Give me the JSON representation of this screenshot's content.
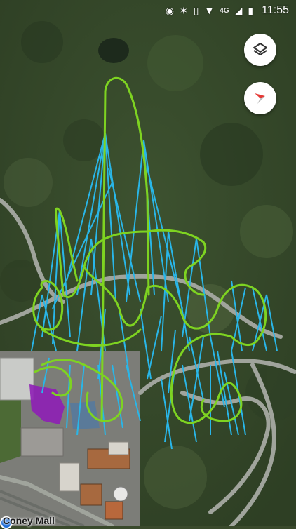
{
  "status_bar": {
    "network": "4G",
    "time": "11:55",
    "icons": [
      "location-icon",
      "bluetooth-icon",
      "vibrate-icon",
      "wifi-icon",
      "signal-icon",
      "battery-icon"
    ]
  },
  "map": {
    "type": "satellite",
    "place_label": "Coney Mall",
    "colors": {
      "track_primary": "#7ed321",
      "supports": "#29b6e8",
      "station_purple": "#8e1fb5",
      "station_blue": "#5a7a99"
    }
  },
  "controls": {
    "layers_icon": "layers-icon",
    "compass_icon": "compass-icon"
  }
}
